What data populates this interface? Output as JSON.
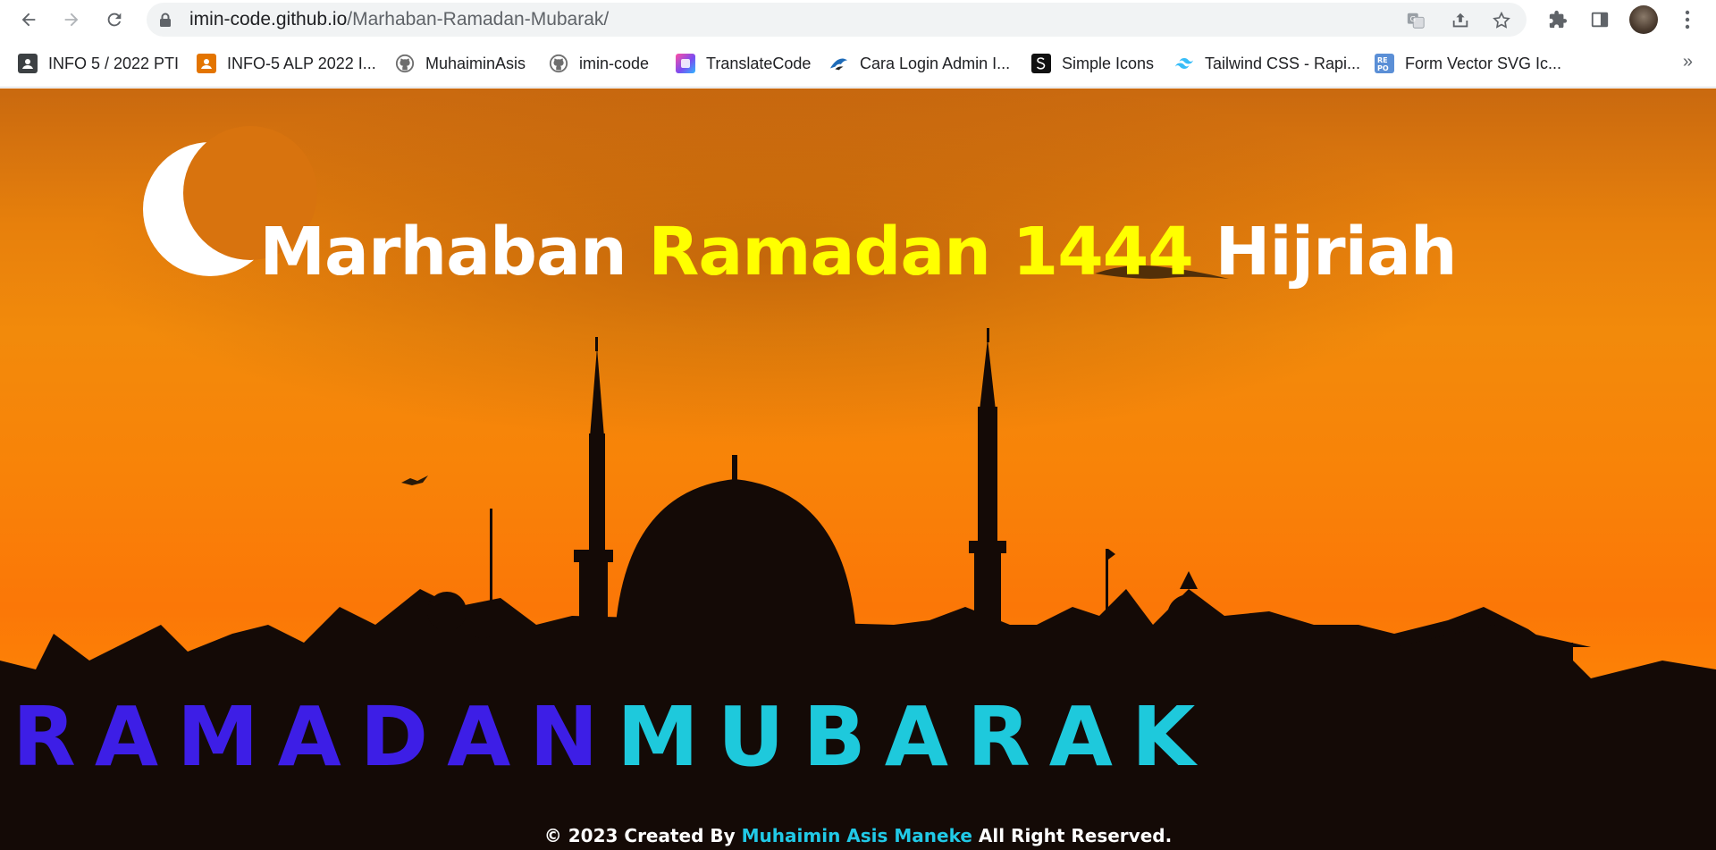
{
  "browser": {
    "url_host": "imin-code.github.io",
    "url_path": "/Marhaban-Ramadan-Mubarak/",
    "icons": {
      "back": "back-arrow-icon",
      "forward": "forward-arrow-icon",
      "reload": "reload-icon",
      "lock": "lock-icon",
      "translate": "translate-icon",
      "share": "share-icon",
      "bookmark": "star-icon",
      "extensions": "puzzle-icon",
      "side_panel": "side-panel-icon",
      "menu": "kebab-menu-icon"
    }
  },
  "bookmarks": [
    {
      "label": "INFO 5 / 2022 PTI",
      "icon": "classroom-icon",
      "color": "#3c4043"
    },
    {
      "label": "INFO-5 ALP 2022 I...",
      "icon": "classroom-icon",
      "color": "#e37400"
    },
    {
      "label": "MuhaiminAsis",
      "icon": "github-icon",
      "color": "#6e6e6e"
    },
    {
      "label": "imin-code",
      "icon": "github-icon",
      "color": "#6e6e6e"
    },
    {
      "label": "TranslateCode",
      "icon": "translatecode-icon",
      "color": "#7b4cf0"
    },
    {
      "label": "Cara Login Admin I...",
      "icon": "bird-logo-icon",
      "color": "#1e6bb8"
    },
    {
      "label": "Simple Icons",
      "icon": "simple-icons-icon",
      "color": "#111111"
    },
    {
      "label": "Tailwind CSS - Rapi...",
      "icon": "tailwind-icon",
      "color": "#38bdf8"
    },
    {
      "label": "Form Vector SVG Ic...",
      "icon": "repo-icon",
      "color": "#5b8fd6"
    }
  ],
  "bookmarks_more": "»",
  "hero": {
    "word1": "Marhaban",
    "word2": "Ramadan 1444",
    "word3": "Hijriah",
    "ramadan_word": "RAMADAN",
    "mubarak_word": "MUBARAK"
  },
  "footer": {
    "prefix": "© 2023 Created By",
    "author": "Muhaimin Asis Maneke",
    "suffix": "All Right Reserved."
  },
  "colors": {
    "highlight_yellow": "#ffff00",
    "ramadan_blue": "#3d1ee6",
    "mubarak_cyan": "#1ec9dc",
    "author_cyan": "#21c9e6"
  }
}
